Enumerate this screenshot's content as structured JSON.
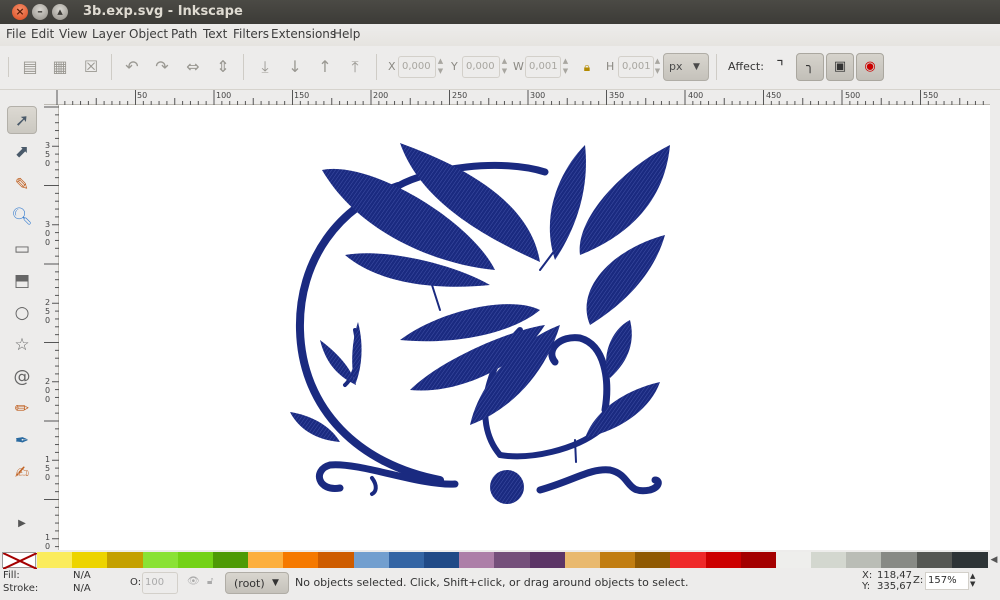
{
  "window": {
    "title": "3b.exp.svg - Inkscape"
  },
  "menu": [
    "File",
    "Edit",
    "View",
    "Layer",
    "Object",
    "Path",
    "Text",
    "Filters",
    "Extensions",
    "Help"
  ],
  "toolbar": {
    "x_label": "X",
    "x_value": "0,000",
    "y_label": "Y",
    "y_value": "0,000",
    "w_label": "W",
    "w_value": "0,001",
    "h_label": "H",
    "h_value": "0,001",
    "unit": "px",
    "affect_label": "Affect:"
  },
  "rulers": {
    "h": [
      "50",
      "100",
      "150",
      "200",
      "250",
      "300",
      "350",
      "400",
      "450",
      "500",
      "550"
    ],
    "v": [
      "3\n5\n0",
      "3\n0\n0",
      "2\n5\n0",
      "2\n0\n0",
      "1\n5\n0",
      "1\n0"
    ]
  },
  "tools": [
    "selector-icon",
    "node-icon",
    "tweak-icon",
    "zoom-icon",
    "rect-icon",
    "3dbox-icon",
    "ellipse-icon",
    "star-icon",
    "spiral-icon",
    "pencil-icon",
    "pen-icon",
    "calligraphy-icon",
    "expand-icon"
  ],
  "artwork": {
    "color": "#1a2a80"
  },
  "palette": [
    "#fbec5d",
    "#edd400",
    "#c4a000",
    "#8ae234",
    "#73d216",
    "#4e9a06",
    "#fcaf3e",
    "#f57900",
    "#ce5c00",
    "#729fcf",
    "#3465a4",
    "#204a87",
    "#ad7fa8",
    "#75507b",
    "#5c3566",
    "#e9b96e",
    "#c17d11",
    "#8f5902",
    "#ef2929",
    "#cc0000",
    "#a40000",
    "#eeeeec",
    "#d3d7cf",
    "#babdb6",
    "#888a85",
    "#555753",
    "#2e3436"
  ],
  "status": {
    "fill_label": "Fill:",
    "fill_value": "N/A",
    "stroke_label": "Stroke:",
    "stroke_value": "N/A",
    "opacity_label": "O:",
    "opacity_value": "100",
    "layer": "(root)",
    "message": "No objects selected. Click, Shift+click, or drag around objects to select.",
    "x_label": "X:",
    "x_value": "118,47",
    "y_label": "Y:",
    "y_value": "335,67",
    "z_label": "Z:",
    "zoom": "157%"
  }
}
